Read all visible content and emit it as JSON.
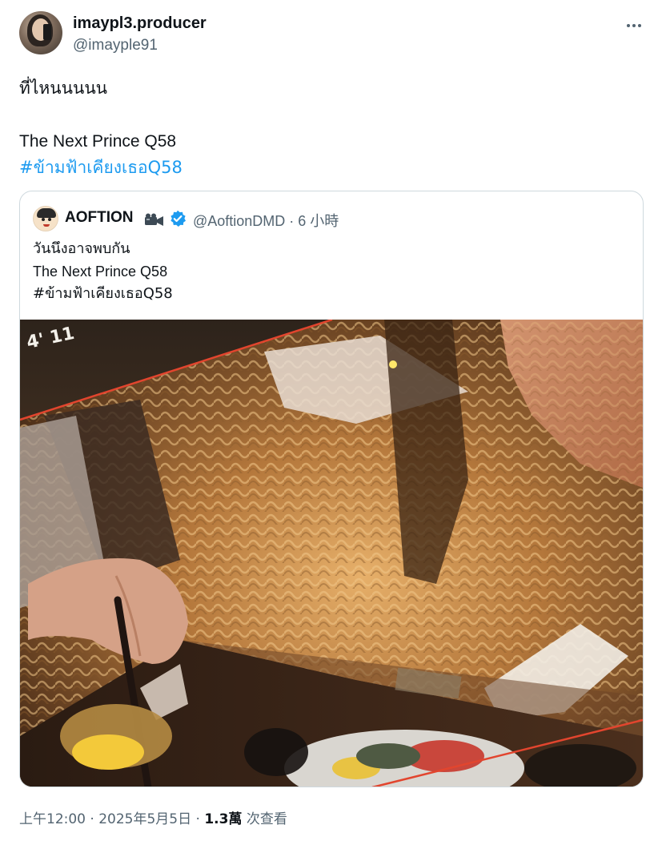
{
  "author": {
    "display_name": "imaypl3.producer",
    "handle": "@imayple91",
    "avatar_icon": "user-avatar-photo"
  },
  "tweet": {
    "lines": [
      "ที่ไหนนนนน",
      "",
      "The Next Prince Q58",
      "#ข้ามฟ้าเคียงเธอQ58"
    ],
    "hashtag": "#ข้ามฟ้าเคียงเธอQ58"
  },
  "quoted_tweet": {
    "display_name": "AOFTION",
    "handle_time": "@AoftionDMD · 6 小時",
    "lines": [
      "วันนึงอาจพบกัน",
      "The Next Prince Q58",
      "#ข้ามฟ้าเคียงเธอQ58"
    ],
    "icons": [
      "movie-camera-icon",
      "verified-badge-icon"
    ],
    "accent_color": "#1d9bf0"
  },
  "meta": {
    "time_date": "上午12:00 · 2025年5月5日 · ",
    "views_count": "1.3萬",
    "views_label": " 次查看"
  },
  "colors": {
    "link": "#1d9bf0",
    "secondary_text": "#536471",
    "border": "#cfd9de"
  }
}
